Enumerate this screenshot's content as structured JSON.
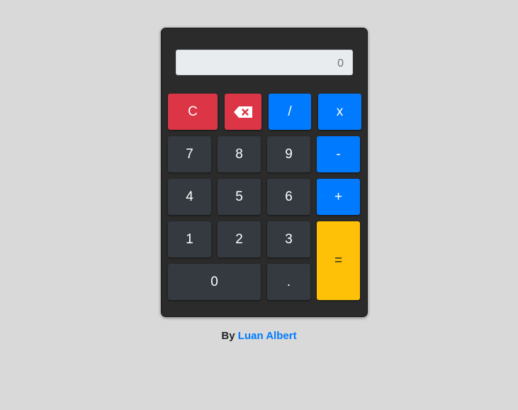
{
  "display": {
    "value": "0"
  },
  "keys": {
    "clear": "C",
    "backspace_icon": "backspace-x-icon",
    "divide": "/",
    "multiply": "x",
    "seven": "7",
    "eight": "8",
    "nine": "9",
    "minus": "-",
    "four": "4",
    "five": "5",
    "six": "6",
    "plus": "+",
    "one": "1",
    "two": "2",
    "three": "3",
    "equals": "=",
    "zero": "0",
    "dot": "."
  },
  "credit": {
    "prefix": "By",
    "author": "Luan Albert"
  },
  "colors": {
    "background": "#d9d9d9",
    "body": "#2b2b2b",
    "dark_key": "#343a40",
    "danger": "#dc3545",
    "primary": "#007bff",
    "warning": "#ffc107"
  }
}
